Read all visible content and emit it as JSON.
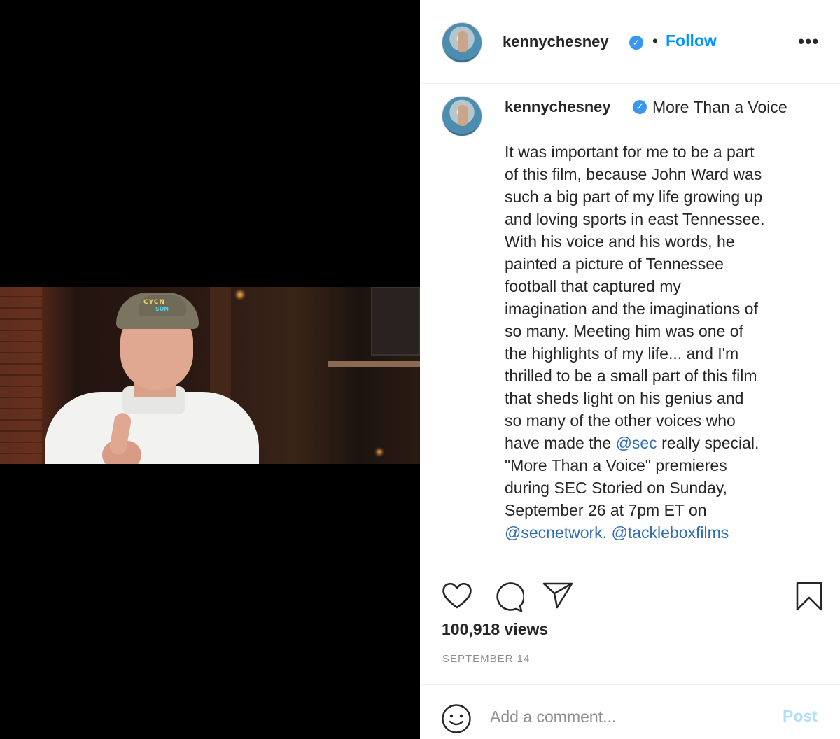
{
  "media": {
    "cap_logo_top": "CYCN",
    "cap_logo_bottom": "SUN"
  },
  "header": {
    "username": "kennychesney",
    "separator": "•",
    "follow_label": "Follow",
    "more_label": "•••"
  },
  "caption": {
    "username": "kennychesney",
    "title": "More Than a Voice",
    "lines": [
      "It was important for me to be a part",
      "of this film, because John Ward was",
      "such a big part of my life growing up",
      "and loving sports in east Tennessee.",
      "With his voice and his words, he",
      "painted a picture of Tennessee",
      "football that captured my",
      "imagination and the imaginations of",
      "so many. Meeting him was one of",
      "the highlights of my life... and I'm",
      "thrilled to be a small part of this film",
      "that sheds light on his genius and",
      "so many of the other voices who"
    ],
    "line14_pre": "have made the ",
    "line14_mention": "@sec",
    "line14_post": " really special.",
    "line15": "\"More Than a Voice\" premieres",
    "line16": "during SEC Storied on Sunday,",
    "line17": "September 26 at 7pm ET on",
    "mention_secnetwork": "@secnetwork.",
    "mention_tacklebox": "@tackleboxfilms"
  },
  "stats": {
    "views": "100,918 views",
    "date": "SEPTEMBER 14"
  },
  "comment": {
    "placeholder": "Add a comment...",
    "post_label": "Post"
  },
  "colors": {
    "accent": "#0095f6",
    "mention": "#2e6db4",
    "verified": "#3897f0",
    "post_disabled": "#b2dffc"
  },
  "icons": {
    "verified": "verified-badge-icon",
    "like": "heart-icon",
    "comment": "comment-bubble-icon",
    "share": "paper-plane-icon",
    "save": "bookmark-icon",
    "emoji": "smiley-icon",
    "more": "more-options-icon"
  }
}
